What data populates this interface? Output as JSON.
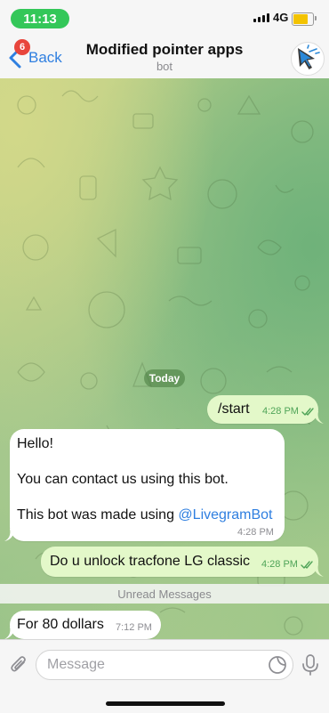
{
  "status_bar": {
    "time": "11:13",
    "network": "4G",
    "battery_level": 0.78
  },
  "header": {
    "back_label": "Back",
    "unread_badge": "6",
    "title": "Modified pointer apps",
    "subtitle": "bot"
  },
  "chat": {
    "date_separator": "Today",
    "messages": [
      {
        "direction": "out",
        "text": "/start",
        "time": "4:28 PM",
        "read": true
      },
      {
        "direction": "in",
        "lines": [
          "Hello!",
          "You can contact us using this bot.",
          "This bot was made using "
        ],
        "link": "@LivegramBot",
        "time": "4:28 PM"
      },
      {
        "direction": "out",
        "text": "Do u unlock tracfone LG classic",
        "time": "4:28 PM",
        "read": true
      },
      {
        "direction": "in",
        "text": "For 80 dollars",
        "time": "7:12 PM"
      }
    ],
    "unread_label": "Unread Messages"
  },
  "input": {
    "placeholder": "Message"
  },
  "colors": {
    "accent": "#2f7fe0",
    "outgoing_bubble": "#e3f8c9",
    "incoming_bubble": "#ffffff",
    "time_pill": "#34c759",
    "badge": "#e8453c"
  },
  "icons": [
    "back-chevron-icon",
    "attach-icon",
    "sticker-icon",
    "mic-icon",
    "double-check-icon",
    "cursor-avatar-icon"
  ]
}
